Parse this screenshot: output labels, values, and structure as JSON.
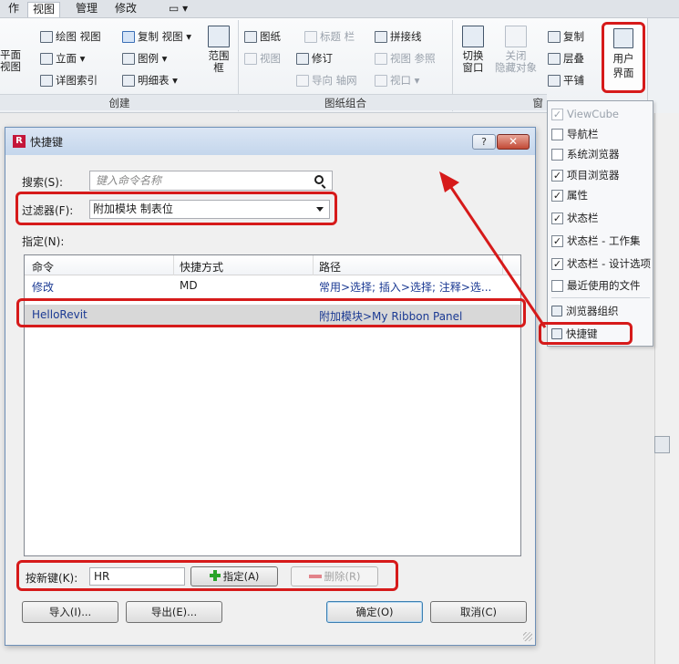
{
  "ribbon": {
    "tabs": [
      "作",
      "视图",
      "管理",
      "修改",
      "▭ ▾"
    ],
    "create_group": {
      "items": [
        "绘图 视图",
        "复制 视图 ▾",
        "立面 ▾",
        "图例 ▾",
        "详图索引",
        "明细表 ▾",
        "平面",
        "视图",
        "范围",
        "框"
      ],
      "label": "创建"
    },
    "sheet_group": {
      "items": [
        "图纸",
        "标题 栏",
        "拼接线",
        "视图",
        "修订",
        "视图 参照",
        "导向 轴网",
        "视口 ▾"
      ],
      "label": "图纸组合"
    },
    "window_group": {
      "items": [
        "切换",
        "窗口",
        "关闭",
        "隐藏对象",
        "复制",
        "层叠",
        "平铺"
      ],
      "label": "窗"
    },
    "user_interface": {
      "line1": "用户",
      "line2": "界面"
    }
  },
  "ui_menu": {
    "items": [
      {
        "label": "ViewCube",
        "checked": true,
        "disabled": true
      },
      {
        "label": "导航栏",
        "checked": false,
        "disabled": false
      },
      {
        "label": "系统浏览器",
        "checked": false,
        "disabled": false
      },
      {
        "label": "项目浏览器",
        "checked": true,
        "disabled": false
      },
      {
        "label": "属性",
        "checked": true,
        "disabled": false
      },
      {
        "label": "状态栏",
        "checked": true,
        "disabled": false
      },
      {
        "label": "状态栏 - 工作集",
        "checked": true,
        "disabled": false
      },
      {
        "label": "状态栏 - 设计选项",
        "checked": true,
        "disabled": false
      },
      {
        "label": "最近使用的文件",
        "checked": false,
        "disabled": false
      }
    ],
    "browser_org": "浏览器组织",
    "shortcuts": "快捷键"
  },
  "dialog": {
    "title": "快捷键",
    "help": "?",
    "close": "✕",
    "search_label": "搜索(S):",
    "search_placeholder": "键入命令名称",
    "filter_label": "过滤器(F):",
    "filter_value": "附加模块 制表位",
    "assign_label": "指定(N):",
    "columns": [
      "命令",
      "快捷方式",
      "路径"
    ],
    "rows": [
      {
        "command": "修改",
        "shortcut": "MD",
        "path": "常用>选择; 插入>选择; 注释>选..."
      },
      {
        "command": "HelloRevit",
        "shortcut": "",
        "path": "附加模块>My Ribbon Panel"
      }
    ],
    "new_key_label": "按新键(K):",
    "new_key_value": "HR",
    "assign_button": "指定(A)",
    "remove_button": "删除(R)",
    "import_button": "导入(I)...",
    "export_button": "导出(E)...",
    "ok_button": "确定(O)",
    "cancel_button": "取消(C)"
  },
  "colors": {
    "highlight": "#d61a1a",
    "link": "#1b3a93"
  }
}
